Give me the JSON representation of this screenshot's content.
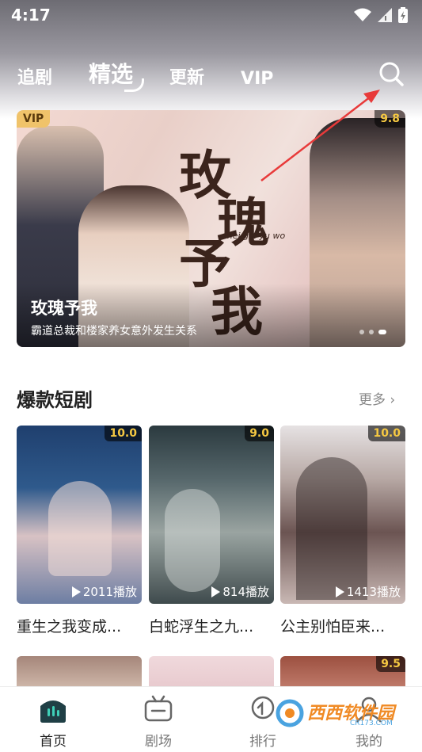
{
  "status_bar": {
    "time": "4:17",
    "icons": [
      "wifi-icon",
      "signal-icon",
      "battery-charging-icon"
    ]
  },
  "top_tabs": [
    {
      "label": "追剧",
      "active": false
    },
    {
      "label": "精选",
      "active": true
    },
    {
      "label": "更新",
      "active": false
    },
    {
      "label": "VIP",
      "active": false
    }
  ],
  "search": {
    "icon": "search-icon"
  },
  "banner": {
    "badge": "VIP",
    "score": "9.8",
    "title": "玫瑰予我",
    "subtitle": "霸道总裁和楼家养女意外发生关系",
    "poster_calligraphy": [
      "玫",
      "瑰",
      "予",
      "我"
    ],
    "poster_pinyin": "mei gui yu wo"
  },
  "section": {
    "title": "爆款短剧",
    "more_label": "更多"
  },
  "cards": [
    {
      "score": "10.0",
      "plays": "2011播放",
      "title": "重生之我变成..."
    },
    {
      "score": "9.0",
      "plays": "814播放",
      "title": "白蛇浮生之九..."
    },
    {
      "score": "10.0",
      "plays": "1413播放",
      "title": "公主别怕臣来..."
    }
  ],
  "row2_cards": [
    {
      "score": ""
    },
    {
      "score": ""
    },
    {
      "score": "9.5"
    }
  ],
  "bottom_nav": [
    {
      "label": "首页",
      "icon": "home-icon",
      "active": true
    },
    {
      "label": "剧场",
      "icon": "tv-icon",
      "active": false
    },
    {
      "label": "排行",
      "icon": "ranking-icon",
      "active": false
    },
    {
      "label": "我的",
      "icon": "profile-icon",
      "active": false
    }
  ],
  "watermark": {
    "text": "西西软件园",
    "sub": "CR173.COM"
  }
}
